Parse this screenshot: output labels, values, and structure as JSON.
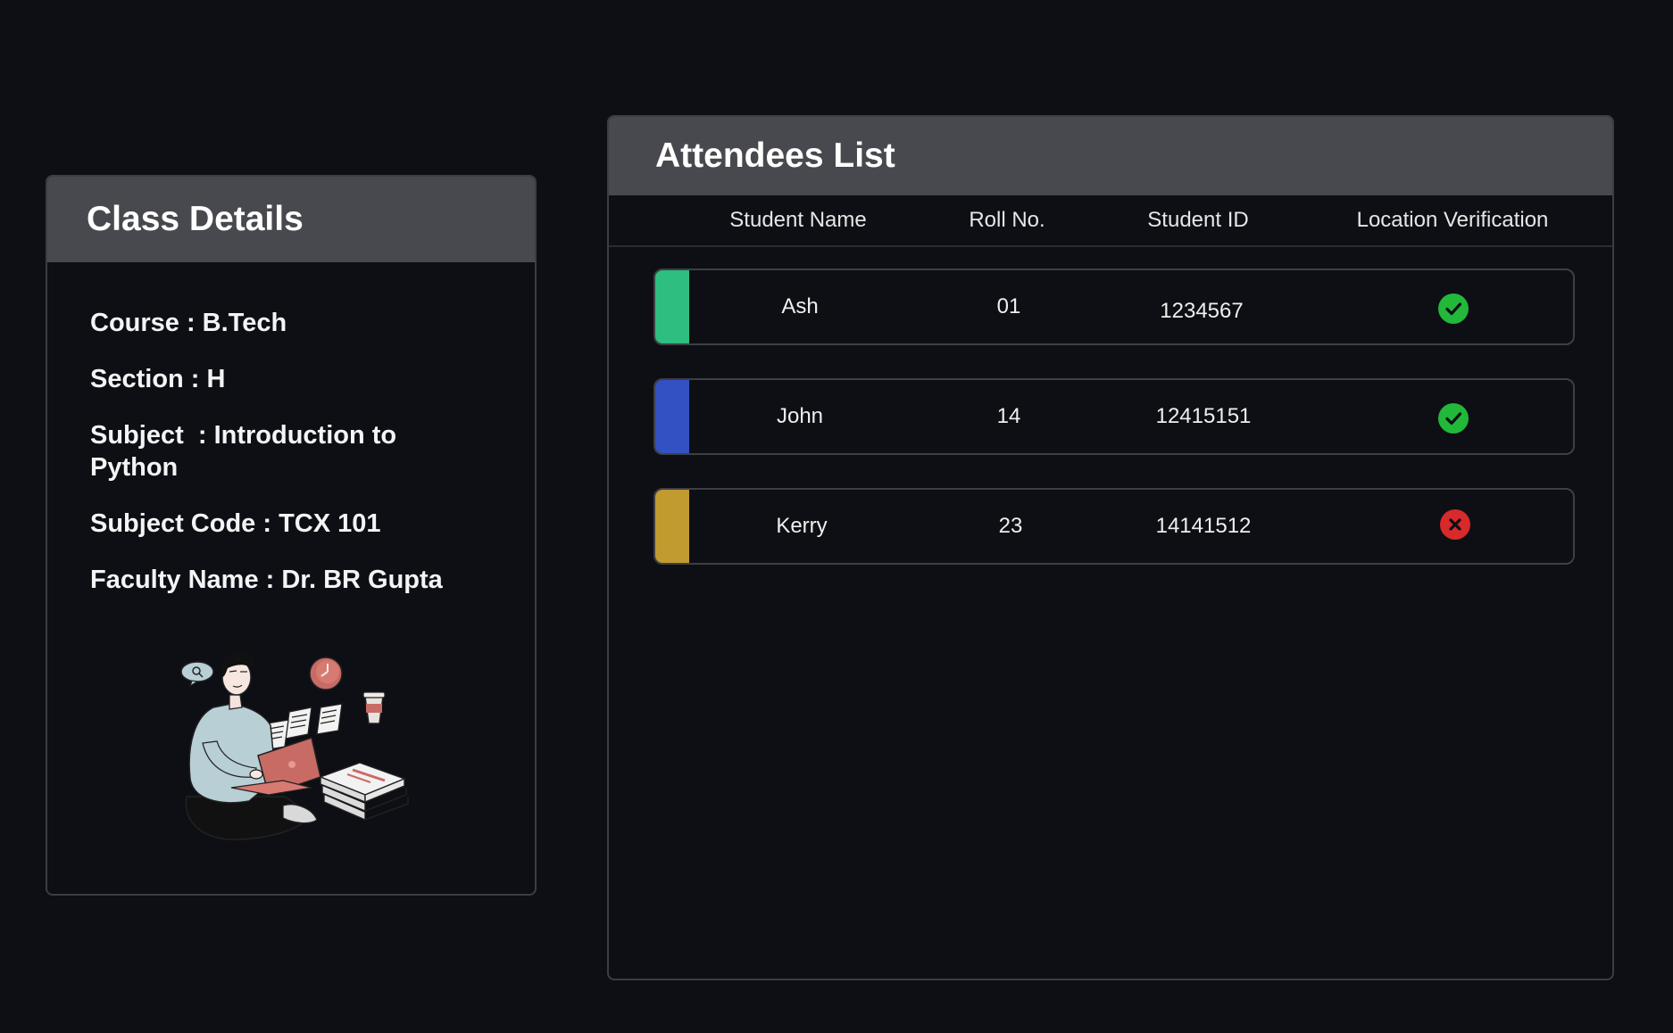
{
  "class_details": {
    "title": "Class Details",
    "course": "Course : B.Tech",
    "section": "Section : H",
    "subject_line1": "Subject  : Introduction to",
    "subject_line2": "Python",
    "subject_code": "Subject Code : TCX 101",
    "faculty": "Faculty Name : Dr. BR Gupta"
  },
  "attendees": {
    "title": "Attendees List",
    "columns": [
      "Student Name",
      "Roll No.",
      "Student ID",
      "Location Verification"
    ],
    "rows": [
      {
        "name": "Ash",
        "roll": "01",
        "id": "1234567",
        "verified": true,
        "accent": "#2ebe7f"
      },
      {
        "name": "John",
        "roll": "14",
        "id": "12415151",
        "verified": true,
        "accent": "#3451c4"
      },
      {
        "name": "Kerry",
        "roll": "23",
        "id": "14141512",
        "verified": false,
        "accent": "#c19a30"
      }
    ]
  },
  "colors": {
    "background": "#0d0f15",
    "header": "#48494e",
    "verified": "#22b83a",
    "not_verified": "#d72a2a"
  },
  "icons": {
    "verified": "check-circle-icon",
    "not_verified": "x-circle-icon",
    "illustration": "student-studying-illustration"
  }
}
